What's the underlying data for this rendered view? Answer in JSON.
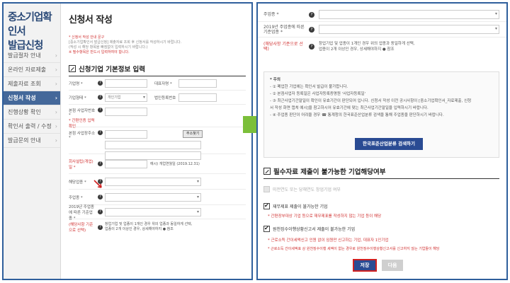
{
  "sidebar": {
    "title_line1": "중소기업확인서",
    "title_line2": "발급신청",
    "items": [
      {
        "label": "발급절차 안내"
      },
      {
        "label": "온라인 자료제출"
      },
      {
        "label": "제출자료 조회"
      },
      {
        "label": "신청서 작성"
      },
      {
        "label": "진행상황 확인"
      },
      {
        "label": "확인서 출력 / 수정"
      },
      {
        "label": "발급문의 안내"
      }
    ]
  },
  "form": {
    "page_title": "신청서 작성",
    "notice1": "* 신청서 작성 안내 문구",
    "notice2": "[중소기업확인서 발급신청] 제출자료 조회 후 신청서를 작성하시기 바랍니다.",
    "notice3": "(작성 시 해당 항목을 빠짐없이 입력하시기 바랍니다.)",
    "notice4": "※ 필수항목은 반드시 입력하여야 합니다.",
    "section_title": "신청기업 기본정보 입력",
    "fields": {
      "company": "기업명 *",
      "ceo": "대표자명 *",
      "company_type": "기업형태 *",
      "company_type_value": "개인기업",
      "corp_no": "법인등록번호",
      "biz_no": "본점 사업자번호 *",
      "biz_no_note": "* 간편인증 입력확인",
      "address": "본점 사업장주소 *",
      "address_btn": "주소찾기",
      "founding": "회사설립(개업)일 *",
      "founding_note": "예시) 개업연월일 (2019.12.31)",
      "industry": "해당업종 *",
      "business_type": "주업종 *",
      "industry_code": "2019년 주업종에 따른 기준업종 *",
      "industry_code_note": "(해당사항 기준으로 선택)",
      "industry_help": "창업기업 및 업종이 1개인 경우 위의 업종과 동일하게 선택,",
      "industry_help2": "업종이 2개 이상인 경우, 상세해야하지 ● 참조"
    }
  },
  "right": {
    "business_type": "주업종 *",
    "industry_code": "2019년 주업종에 따른 기준업종 *",
    "industry_code_note": "(해당사항 기준으로 선택)",
    "industry_help": "창업기업 및 업종이 1개인 경우 위의 업종과 동일하게 선택,",
    "industry_help2": "업종이 2개 이상인 경우, 상세해야하지 ● 참조",
    "notice_title": "* 주의",
    "notice_lines": [
      "- ① 폐업한 기업에는 확인서 발급이 불가합니다.",
      "- ② 본점사업자 등록일은 사업자등록증명원 '사업자등록일'",
      "- ③ 최근사업기간말일이 확인이 유효기간이 판단되어 입니다. 신청서 작성 이전 공시사항이 [중소기업확인서_자료제출, 신청",
      "  서 작성 화면 캡쳐 예시]을 참고하시어 유효기간에 맞는 최근사업기간말일을 입력하시기 바랍니다.",
      "- ④ 주업종 판단이 어려울 경우 ☎ 통계청의 한국표준산업분류 검색을 통해 주업종을 판단하시기 바랍니다."
    ],
    "search_btn": "한국표준산업분류 검색하기",
    "section2_title": "필수자료 제출이 불가능한 기업해당여부",
    "opt1": "미전연도 또는 당해연도 창업기업 여부",
    "opt2": "재무제표 제출이 불가능한 기업",
    "opt2_sub": "* 간편장부대상 기업 등으로 재무제표를 작성하지 않는 기업 등이 해당",
    "opt3": "원천징수이행상황신고서 제출이 불가능한 기업",
    "opt3_sub1": "* 근로소득 간이세액신고 인원 없이 임원만 신고하는 기업, 대표자 1인기업",
    "opt3_sub2": "* 근로소득 간이세액표 상 원천징수이행 세액이 없는 경우로 원천징수이행상황신고서를 신고하지 않는 기업들이 해당",
    "save_btn": "저장",
    "next_btn": "다음"
  },
  "colors": {
    "accent_blue": "#2a4b93",
    "sidebar_active": "#44689a",
    "notice_red": "#d03030",
    "frame_blue": "#2f5f9c",
    "arrow_green": "#7bbf3a"
  }
}
